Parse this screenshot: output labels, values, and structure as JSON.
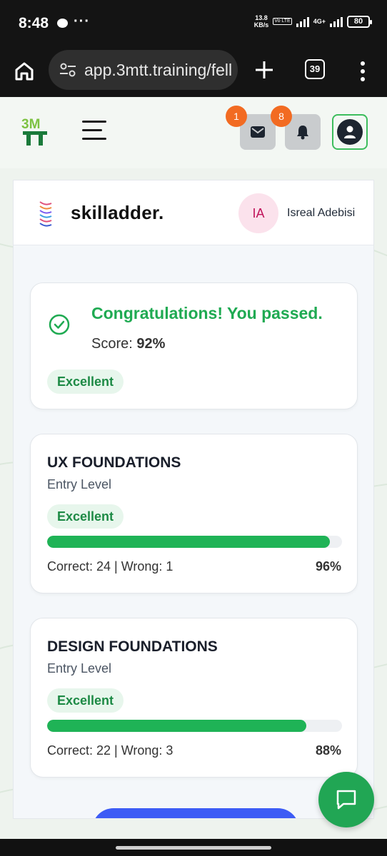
{
  "status_bar": {
    "time": "8:48",
    "dots": "···",
    "net_speed_value": "13.8",
    "net_speed_unit": "KB/s",
    "volte": "Vo LTE",
    "network_type": "4G+",
    "battery": "80"
  },
  "browser": {
    "url": "app.3mtt.training/fell",
    "tab_count": "39"
  },
  "header": {
    "logo_text": "3MTT",
    "mail_badge": "1",
    "bell_badge": "8"
  },
  "panel": {
    "brand": "skilladder.",
    "avatar_initials": "IA",
    "user_name": "Isreal Adebisi"
  },
  "result": {
    "title": "Congratulations! You passed.",
    "score_label": "Score:",
    "score_value": "92%",
    "rating": "Excellent"
  },
  "courses": [
    {
      "title": "UX FOUNDATIONS",
      "level": "Entry Level",
      "rating": "Excellent",
      "stats": "Correct: 24 | Wrong: 1",
      "percent": "96%",
      "progress": 0.96
    },
    {
      "title": "DESIGN FOUNDATIONS",
      "level": "Entry Level",
      "rating": "Excellent",
      "stats": "Correct: 22 | Wrong: 3",
      "percent": "88%",
      "progress": 0.88
    }
  ],
  "colors": {
    "accent_green": "#1faa52",
    "progress_green": "#1fb356",
    "badge_orange": "#f26b22",
    "primary_blue": "#3d5cf5"
  },
  "icons": [
    "home-icon",
    "url-settings-icon",
    "plus-icon",
    "more-vert-icon",
    "mail-icon",
    "bell-icon",
    "user-icon",
    "check-circle-icon",
    "chat-icon"
  ]
}
